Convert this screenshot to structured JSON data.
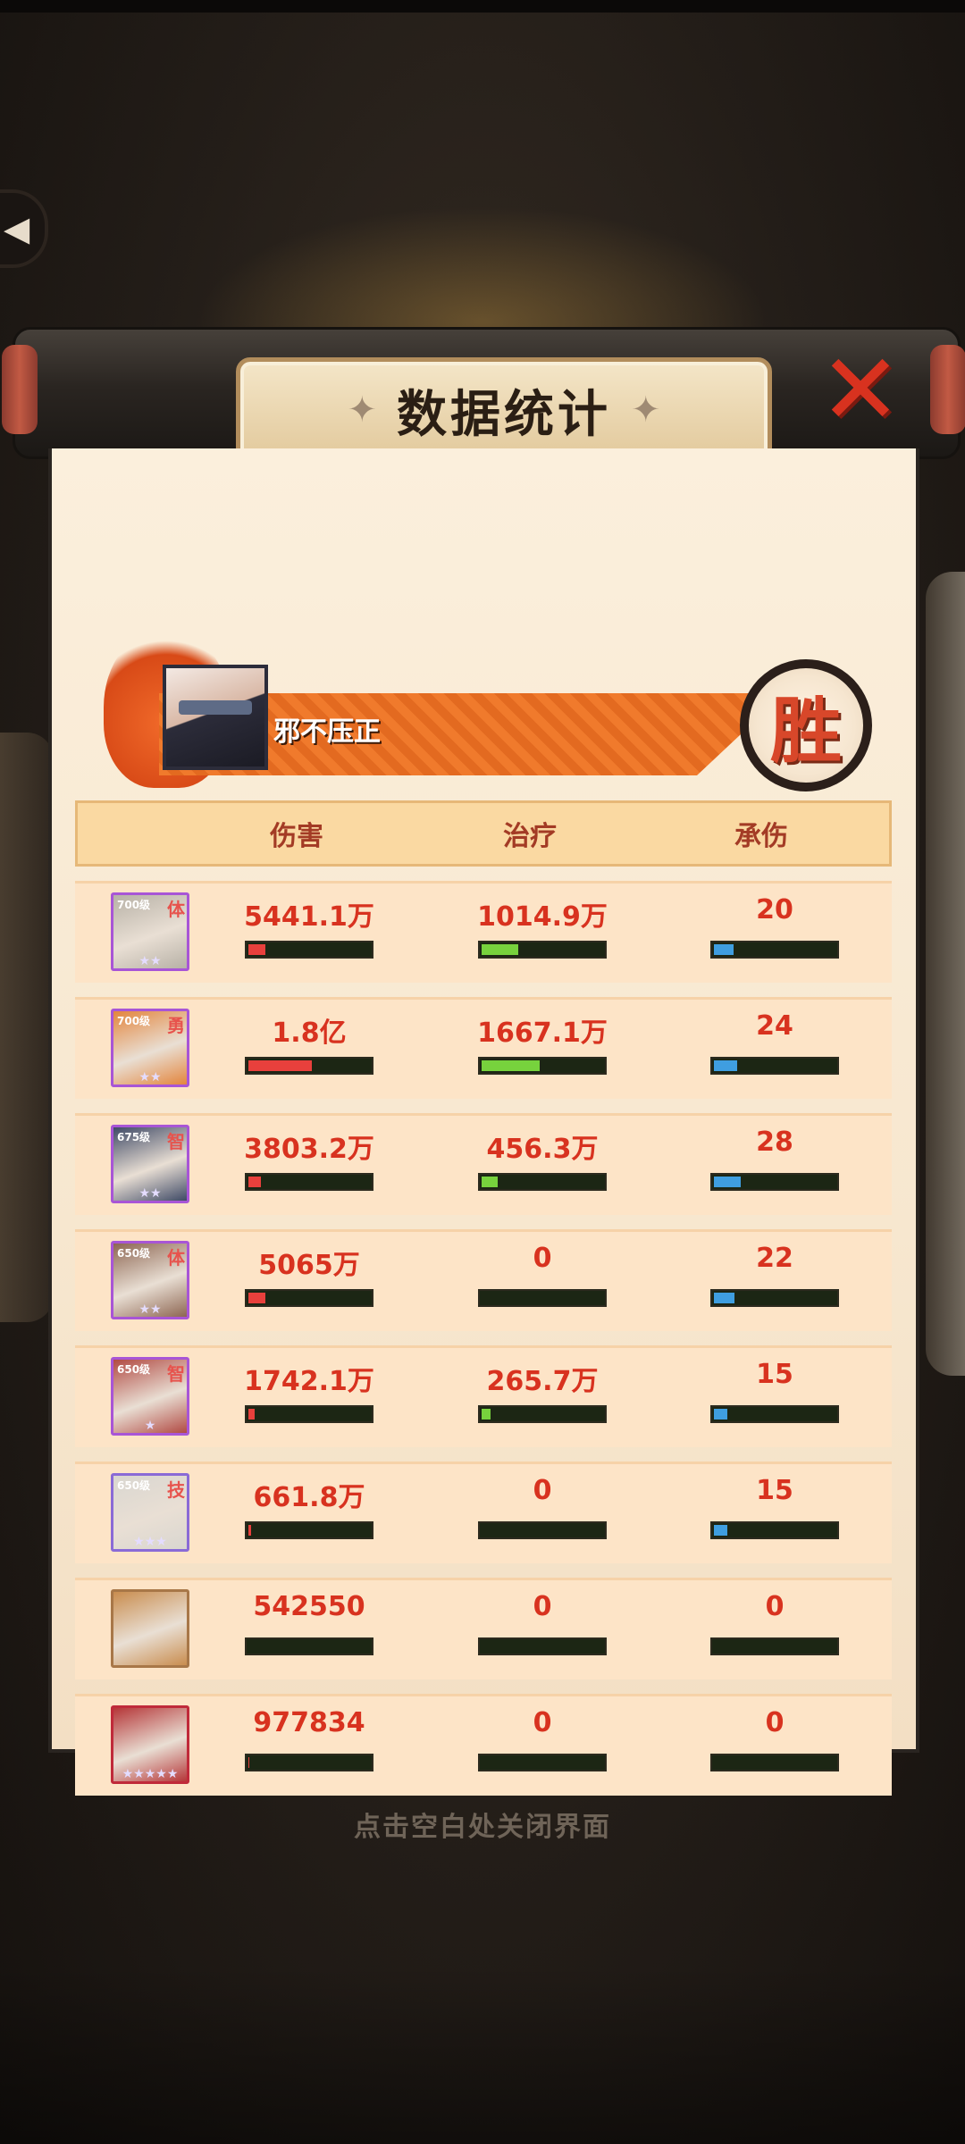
{
  "title": "数据统计",
  "player": {
    "name": "邪不压正",
    "result_badge": "胜"
  },
  "columns": [
    "伤害",
    "治疗",
    "承伤"
  ],
  "rows": [
    {
      "level": "700级",
      "tag": "体",
      "stars": "★★",
      "border": "#a855d6",
      "bg": "#b7b1a6",
      "damage": "5441.1万",
      "heal": "1014.9万",
      "taken": "20",
      "damage_pct": 14,
      "heal_pct": 30,
      "taken_pct": 16
    },
    {
      "level": "700级",
      "tag": "勇",
      "stars": "★★",
      "border": "#a855d6",
      "bg": "#e3853d",
      "damage": "1.8亿",
      "heal": "1667.1万",
      "taken": "24",
      "damage_pct": 52,
      "heal_pct": 48,
      "taken_pct": 19
    },
    {
      "level": "675级",
      "tag": "智",
      "stars": "★★",
      "border": "#a855d6",
      "bg": "#3f4a66",
      "damage": "3803.2万",
      "heal": "456.3万",
      "taken": "28",
      "damage_pct": 10,
      "heal_pct": 13,
      "taken_pct": 22
    },
    {
      "level": "650级",
      "tag": "体",
      "stars": "★★",
      "border": "#a855d6",
      "bg": "#8d6652",
      "damage": "5065万",
      "heal": "0",
      "taken": "22",
      "damage_pct": 14,
      "heal_pct": 0,
      "taken_pct": 17
    },
    {
      "level": "650级",
      "tag": "智",
      "stars": "★",
      "border": "#a855d6",
      "bg": "#b14a43",
      "damage": "1742.1万",
      "heal": "265.7万",
      "taken": "15",
      "damage_pct": 5,
      "heal_pct": 7,
      "taken_pct": 11
    },
    {
      "level": "650级",
      "tag": "技",
      "stars": "★★★",
      "border": "#8a6ad6",
      "bg": "#d9d6d0",
      "damage": "661.8万",
      "heal": "0",
      "taken": "15",
      "damage_pct": 2,
      "heal_pct": 0,
      "taken_pct": 11
    },
    {
      "level": "",
      "tag": "",
      "stars": "",
      "border": "#a87748",
      "bg": "#c98d4f",
      "damage": "542550",
      "heal": "0",
      "taken": "0",
      "damage_pct": 0,
      "heal_pct": 0,
      "taken_pct": 0
    },
    {
      "level": "",
      "tag": "",
      "stars": "★★★★★",
      "border": "#c02a3a",
      "bg": "#b53638",
      "damage": "977834",
      "heal": "0",
      "taken": "0",
      "damage_pct": 1,
      "heal_pct": 0,
      "taken_pct": 0
    }
  ],
  "colors": {
    "damage": "#e8403c",
    "heal": "#77d23d",
    "taken": "#3f9ee0",
    "value_text": "#d8321f"
  },
  "hint": "点击空白处关闭界面"
}
